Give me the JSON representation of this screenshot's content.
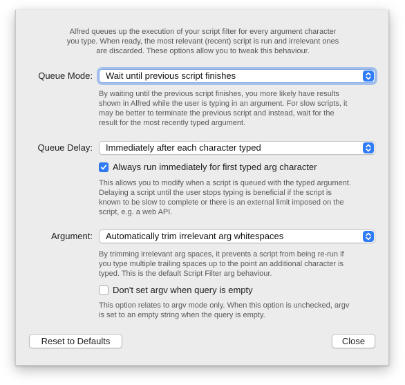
{
  "intro": {
    "line1": "Alfred queues up the execution of your script filter for every argument character",
    "line2": "you type. When ready, the most relevant (recent) script is run and irrelevant ones",
    "line3": "are discarded. These options allow you to tweak this behaviour."
  },
  "queue_mode": {
    "label": "Queue Mode:",
    "value": "Wait until previous script finishes",
    "help": [
      "By waiting until the previous script finishes, you more likely have results",
      "shown in Alfred while the user is typing in an argument. For slow scripts, it",
      "may be better to terminate the previous script and instead, wait for the",
      "result for the most recently typed argument."
    ]
  },
  "queue_delay": {
    "label": "Queue Delay:",
    "value": "Immediately after each character typed",
    "checkbox_label": "Always run immediately for first typed arg character",
    "checkbox_checked": true,
    "help": [
      "This allows you to modify when a script is queued with the typed argument.",
      "Delaying a script until the user stops typing is beneficial if the script is",
      "known to be slow to complete or there is an external limit imposed on the",
      "script, e.g. a web API."
    ]
  },
  "argument": {
    "label": "Argument:",
    "value": "Automatically trim irrelevant arg whitespaces",
    "help": [
      "By trimming irrelevant arg spaces, it prevents a script from being re-run if",
      "you type multiple trailing spaces up to the point an additional character is",
      "typed. This is the default Script Filter arg behaviour."
    ],
    "checkbox_label": "Don't set argv when query is empty",
    "checkbox_checked": false,
    "checkbox_help": [
      "This option relates to argv mode only. When this option is unchecked, argv",
      "is set to an empty string when the query is empty."
    ]
  },
  "buttons": {
    "reset": "Reset to Defaults",
    "close": "Close"
  },
  "colors": {
    "accent": "#2f7cf6",
    "sheet_bg": "#ececec"
  }
}
